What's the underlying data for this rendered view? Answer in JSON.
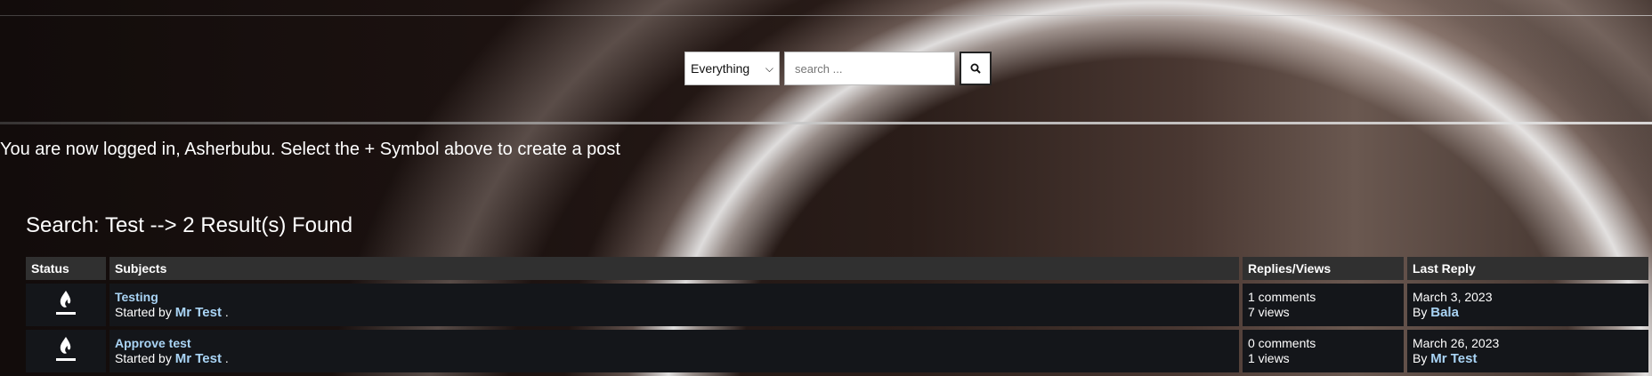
{
  "search": {
    "scope_value": "Everything",
    "placeholder": "search ..."
  },
  "login_message": "You are now logged in, Asherbubu. Select the + Symbol above to create a post",
  "results_title": "Search: Test --> 2 Result(s) Found",
  "table": {
    "headers": {
      "status": "Status",
      "subjects": "Subjects",
      "replies_views": "Replies/Views",
      "last_reply": "Last Reply"
    },
    "rows": [
      {
        "status_icon": "flame-icon",
        "title": "Testing",
        "started_by_prefix": "Started by",
        "author": "Mr Test",
        "suffix": ".",
        "comments": "1 comments",
        "views": "7 views",
        "last_reply_date": "March 3, 2023",
        "by_prefix": "By",
        "last_reply_user": "Bala"
      },
      {
        "status_icon": "flame-icon",
        "title": "Approve test",
        "started_by_prefix": "Started by",
        "author": "Mr Test",
        "suffix": ".",
        "comments": "0 comments",
        "views": "1 views",
        "last_reply_date": "March 26, 2023",
        "by_prefix": "By",
        "last_reply_user": "Mr Test"
      }
    ]
  }
}
